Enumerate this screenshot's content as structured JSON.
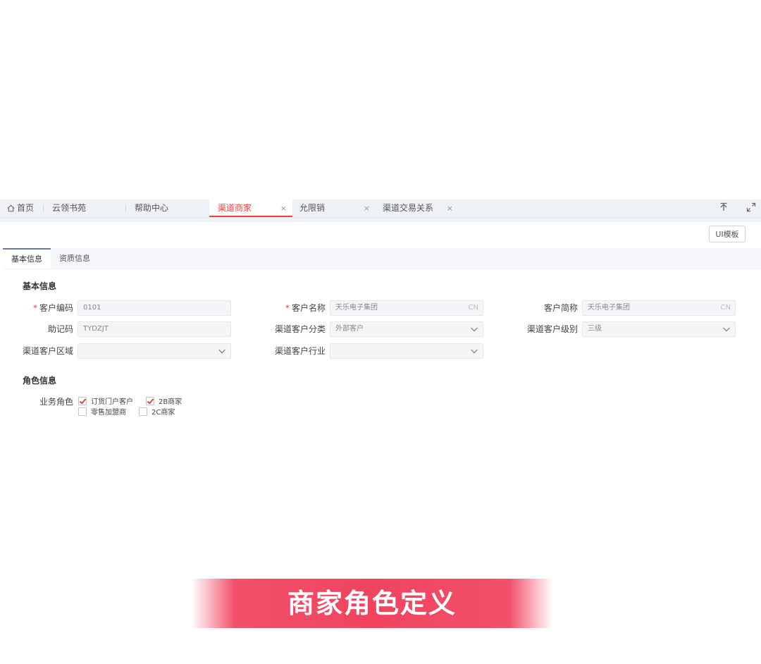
{
  "tabs": [
    {
      "label": "首页",
      "icon": "home-icon",
      "closable": false
    },
    {
      "label": "云领书苑",
      "closable": false
    },
    {
      "label": "帮助中心",
      "closable": false
    },
    {
      "label": "渠道商家",
      "closable": true,
      "active": true
    },
    {
      "label": "允限销",
      "closable": true
    },
    {
      "label": "渠道交易关系",
      "closable": true
    }
  ],
  "close_glyph": "×",
  "toolbar": {
    "template_button": "UI模板",
    "upload_icon": "upload-icon",
    "fullscreen_icon": "fullscreen-icon"
  },
  "subtabs": [
    "基本信息",
    "资质信息"
  ],
  "basic": {
    "section_title": "基本信息",
    "customer_code_label": "客户编码",
    "customer_code_value": "0101",
    "customer_name_label": "客户名称",
    "customer_name_value": "天乐电子集团",
    "customer_name_suffix": "CN",
    "short_name_label": "客户简称",
    "short_name_value": "天乐电子集团",
    "short_name_suffix": "CN",
    "mnemonic_label": "助记码",
    "mnemonic_value": "TYDZJT",
    "category_label": "渠道客户分类",
    "category_value": "外部客户",
    "level_label": "渠道客户级别",
    "level_value": "三级",
    "region_label": "渠道客户区域",
    "region_value": "",
    "industry_label": "渠道客户行业",
    "industry_value": "",
    "required_mark": "*"
  },
  "roles": {
    "section_title": "角色信息",
    "label": "业务角色",
    "options": [
      {
        "label": "订货门户客户",
        "checked": true
      },
      {
        "label": "2B商家",
        "checked": true
      },
      {
        "label": "零售加盟商",
        "checked": false
      },
      {
        "label": "2C商家",
        "checked": false
      }
    ]
  },
  "caption": "商家角色定义",
  "colors": {
    "accent": "#e8453c",
    "banner": "#f0445f"
  }
}
